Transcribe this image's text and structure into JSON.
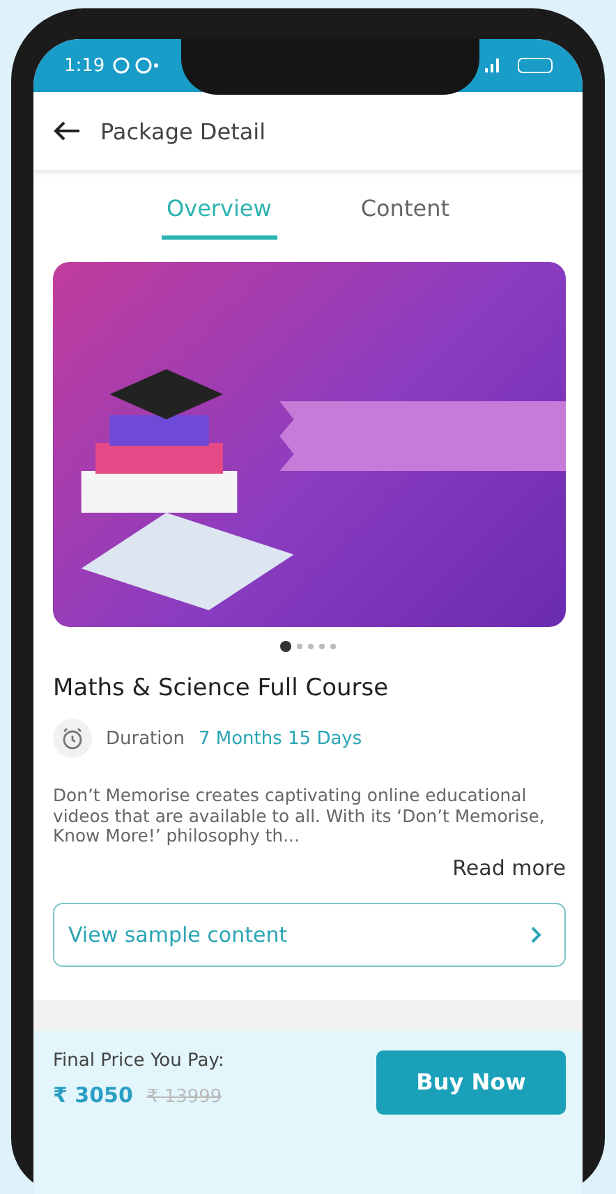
{
  "status_bar": {
    "time": "1:19"
  },
  "header": {
    "title": "Package Detail"
  },
  "tabs": [
    {
      "label": "Overview",
      "selected": true
    },
    {
      "label": "Content",
      "selected": false
    }
  ],
  "carousel": {
    "dots": [
      {
        "selected": true
      },
      {
        "selected": false
      },
      {
        "selected": false
      },
      {
        "selected": false
      },
      {
        "selected": false
      }
    ]
  },
  "course": {
    "title": "Maths & Science Full Course",
    "duration_label": "Duration",
    "duration_value": "7 Months 15 Days",
    "description": "Don’t Memorise creates captivating online educational videos that are available to all. With its ‘Don’t Memorise, Know More!’ philosophy th...",
    "read_more": "Read more"
  },
  "sample_button": {
    "label": "View sample content"
  },
  "footer": {
    "price_label": "Final Price You Pay:",
    "price": "₹ 3050",
    "original_price": "₹ 13999",
    "buy_button": "Buy Now"
  }
}
